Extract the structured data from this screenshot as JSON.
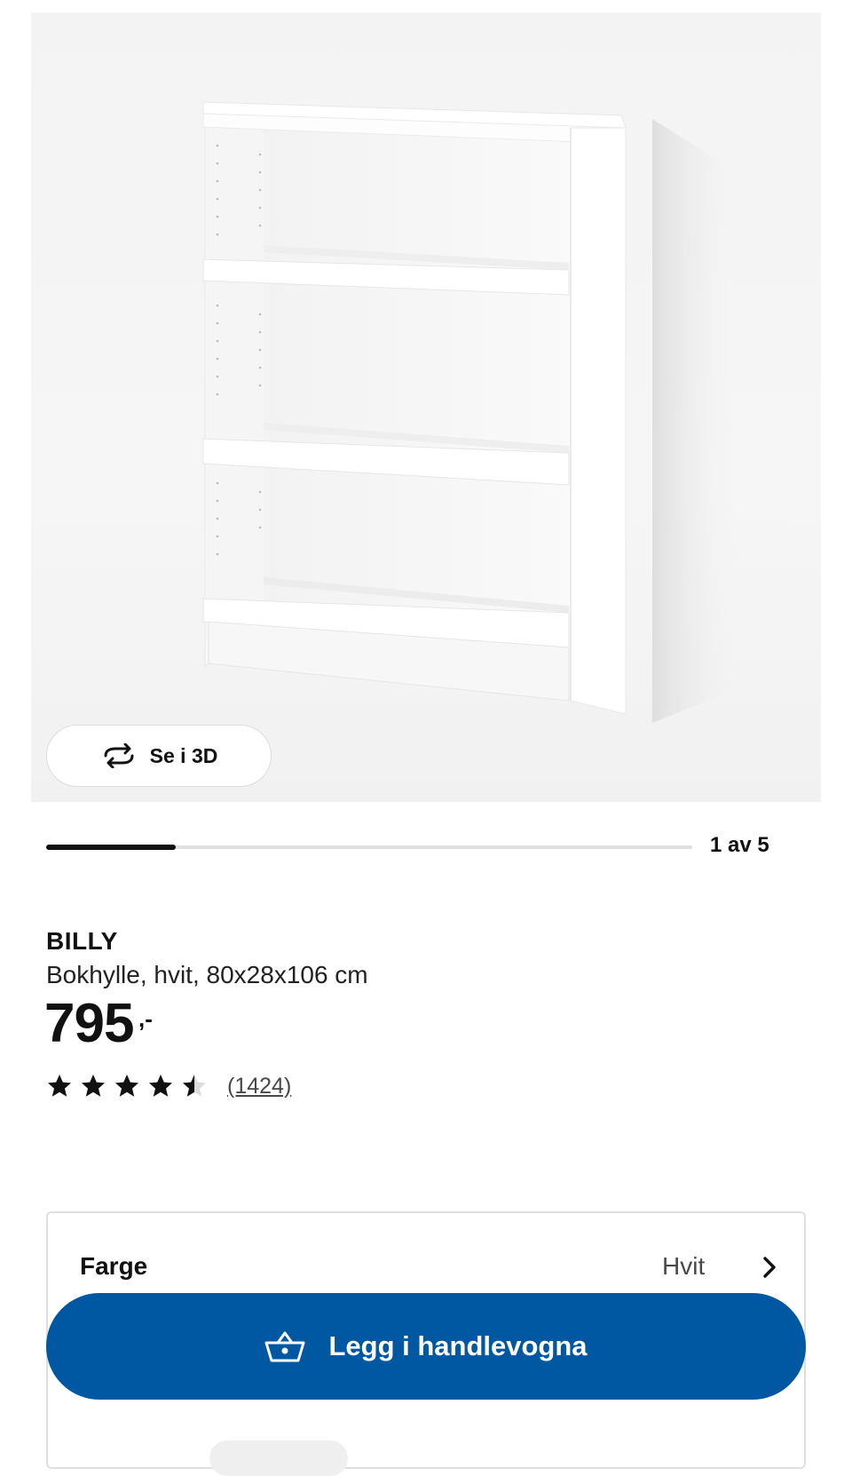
{
  "gallery": {
    "view_3d_label": "Se i 3D",
    "current_index": 1,
    "total": 5,
    "counter_text": "1 av 5",
    "progress_fraction": 0.2
  },
  "product": {
    "brand": "BILLY",
    "description": "Bokhylle, hvit, 80x28x106 cm",
    "price": "795",
    "price_suffix": ",-",
    "rating": 4.5,
    "rating_max": 5,
    "review_count_text": "(1424)"
  },
  "color_selector": {
    "label": "Farge",
    "value": "Hvit",
    "icon": "chevron-right-icon"
  },
  "cart_button": {
    "label": "Legg i handlevogna",
    "icon": "shopping-basket-icon"
  },
  "colors": {
    "accent": "#0058a3",
    "text": "#111111",
    "muted": "#484848"
  }
}
